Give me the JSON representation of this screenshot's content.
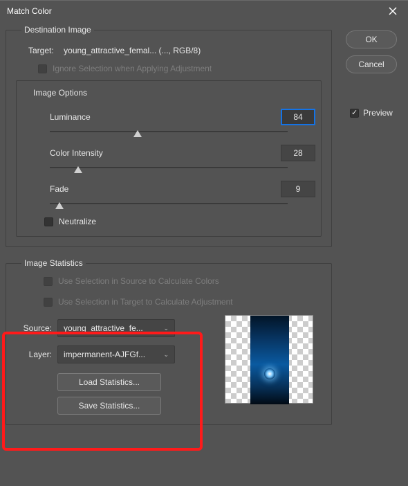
{
  "title": "Match Color",
  "buttons": {
    "ok": "OK",
    "cancel": "Cancel"
  },
  "preview": {
    "label": "Preview",
    "checked": true
  },
  "dest": {
    "legend": "Destination Image",
    "target_label": "Target:",
    "target_value": "young_attractive_femal... (..., RGB/8)",
    "ignore_selection": "Ignore Selection when Applying Adjustment"
  },
  "image_options": {
    "legend": "Image Options",
    "luminance": {
      "label": "Luminance",
      "value": "84",
      "pos": 37
    },
    "color_intensity": {
      "label": "Color Intensity",
      "value": "28",
      "pos": 12
    },
    "fade": {
      "label": "Fade",
      "value": "9",
      "pos": 4
    },
    "neutralize": "Neutralize"
  },
  "stats": {
    "legend": "Image Statistics",
    "use_src": "Use Selection in Source to Calculate Colors",
    "use_tgt": "Use Selection in Target to Calculate Adjustment",
    "source_label": "Source:",
    "source_value": "young_attractive_fe...",
    "layer_label": "Layer:",
    "layer_value": "impermanent-AJFGf...",
    "load": "Load Statistics...",
    "save": "Save Statistics..."
  }
}
